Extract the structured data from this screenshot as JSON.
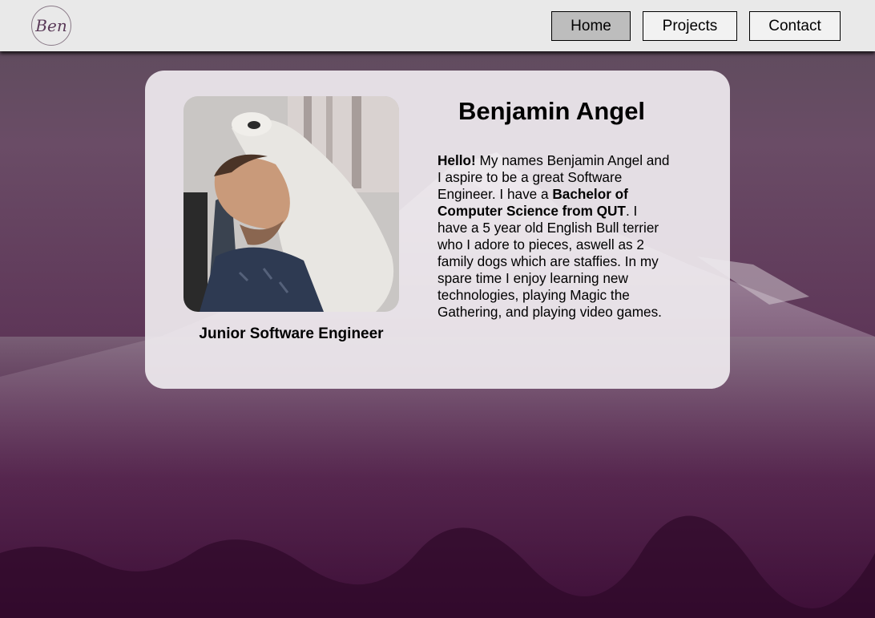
{
  "nav": {
    "logo_text": "Ben",
    "items": [
      {
        "label": "Home",
        "active": true
      },
      {
        "label": "Projects",
        "active": false
      },
      {
        "label": "Contact",
        "active": false
      }
    ]
  },
  "profile": {
    "name": "Benjamin Angel",
    "role": "Junior Software Engineer",
    "bio": {
      "greeting": "Hello!",
      "part1": " My names Benjamin Angel and I aspire to be a great Software Engineer. I have a ",
      "degree": "Bachelor of Computer Science from QUT",
      "part2": ". I have a 5 year old English Bull terrier who I adore to pieces, aswell as 2 family dogs which are staffies. In my spare time I enjoy learning new technologies, playing Magic the Gathering, and playing video games."
    }
  },
  "colors": {
    "nav_bg": "#e9e9e9",
    "active_button": "#bdbdbd",
    "background_tint": "#3d0e37",
    "card_bg": "#eeeaee"
  },
  "icons": {
    "logo": "ben-signature-logo"
  }
}
